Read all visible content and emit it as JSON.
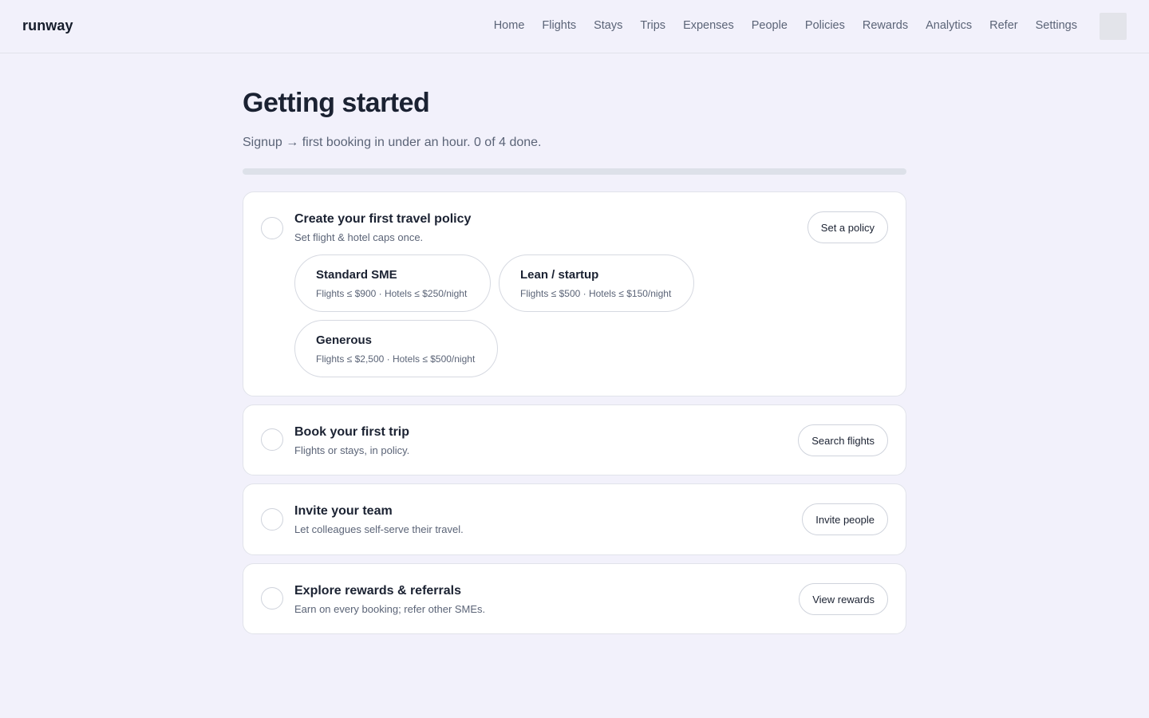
{
  "brand": "runway",
  "nav": [
    "Home",
    "Flights",
    "Stays",
    "Trips",
    "Expenses",
    "People",
    "Policies",
    "Rewards",
    "Analytics",
    "Refer",
    "Settings"
  ],
  "page": {
    "title": "Getting started",
    "subtitle": "Signup → first booking in under an hour. 0 of 4 done.",
    "progress": 0
  },
  "steps": [
    {
      "title": "Create your first travel policy",
      "description": "Set flight & hotel caps once.",
      "action": "Set a policy",
      "done": false,
      "presets": [
        {
          "name": "Standard SME",
          "detail": "Flights ≤ $900 · Hotels ≤ $250/night"
        },
        {
          "name": "Lean / startup",
          "detail": "Flights ≤ $500 · Hotels ≤ $150/night"
        },
        {
          "name": "Generous",
          "detail": "Flights ≤ $2,500 · Hotels ≤ $500/night"
        }
      ]
    },
    {
      "title": "Book your first trip",
      "description": "Flights or stays, in policy.",
      "action": "Search flights",
      "done": false
    },
    {
      "title": "Invite your team",
      "description": "Let colleagues self-serve their travel.",
      "action": "Invite people",
      "done": false
    },
    {
      "title": "Explore rewards & referrals",
      "description": "Earn on every booking; refer other SMEs.",
      "action": "View rewards",
      "done": false
    }
  ]
}
